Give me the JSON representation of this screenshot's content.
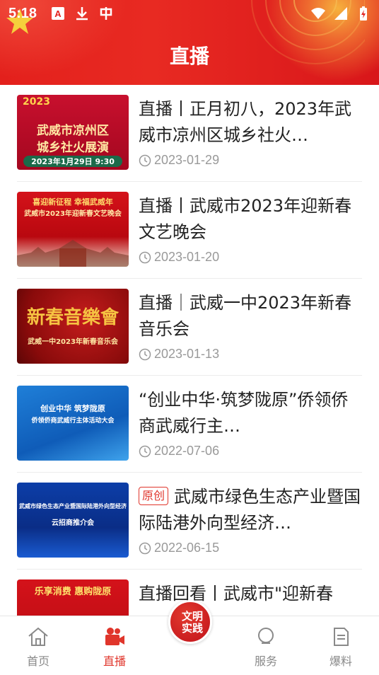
{
  "status_bar": {
    "time": "5:18",
    "left_icons": [
      "font-app-icon",
      "download-icon",
      "notification-app-icon"
    ],
    "right_icons": [
      "wifi-icon",
      "signal-icon",
      "battery-charging-icon"
    ]
  },
  "header": {
    "title": "直播",
    "background_color": "#e3201c"
  },
  "items": [
    {
      "title": "直播丨正月初八，2023年武威市凉州区城乡社火…",
      "date": "2023-01-29",
      "badge": "",
      "thumb_lines": [
        "2023",
        "武威市凉州区",
        "城乡社火展演",
        "2023年1月29日 9:30"
      ]
    },
    {
      "title": "直播丨武威市2023年迎新春文艺晚会",
      "date": "2023-01-20",
      "badge": "",
      "thumb_lines": [
        "喜迎新征程 幸福武威年",
        "武威市2023年迎新春文艺晚会"
      ]
    },
    {
      "title": "直播｜武威一中2023年新春音乐会",
      "date": "2023-01-13",
      "badge": "",
      "thumb_lines": [
        "新春音樂會",
        "武威一中2023年新春音乐会"
      ]
    },
    {
      "title": "“创业中华·筑梦陇原”侨领侨商武威行主…",
      "date": "2022-07-06",
      "badge": "",
      "thumb_lines": [
        "创业中华 筑梦陇原",
        "侨领侨商武威行主体活动大会"
      ]
    },
    {
      "title": "武威市绿色生态产业暨国际陆港外向型经济…",
      "date": "2022-06-15",
      "badge": "原创",
      "thumb_lines": [
        "武威市绿色生态产业暨国际陆港外向型经济",
        "云招商推介会"
      ]
    },
    {
      "title": "直播回看丨武威市\"迎新春",
      "date": "",
      "badge": "",
      "thumb_lines": [
        "乐享消费 惠购陇原"
      ]
    }
  ],
  "bottom_nav": {
    "items": [
      {
        "label": "首页",
        "icon": "home-icon",
        "active": false
      },
      {
        "label": "直播",
        "icon": "video-camera-icon",
        "active": true
      },
      {
        "label": "服务",
        "icon": "service-icon",
        "active": false
      },
      {
        "label": "爆料",
        "icon": "report-icon",
        "active": false
      }
    ],
    "center_label": "文明实践",
    "active_color": "#e0352b"
  }
}
